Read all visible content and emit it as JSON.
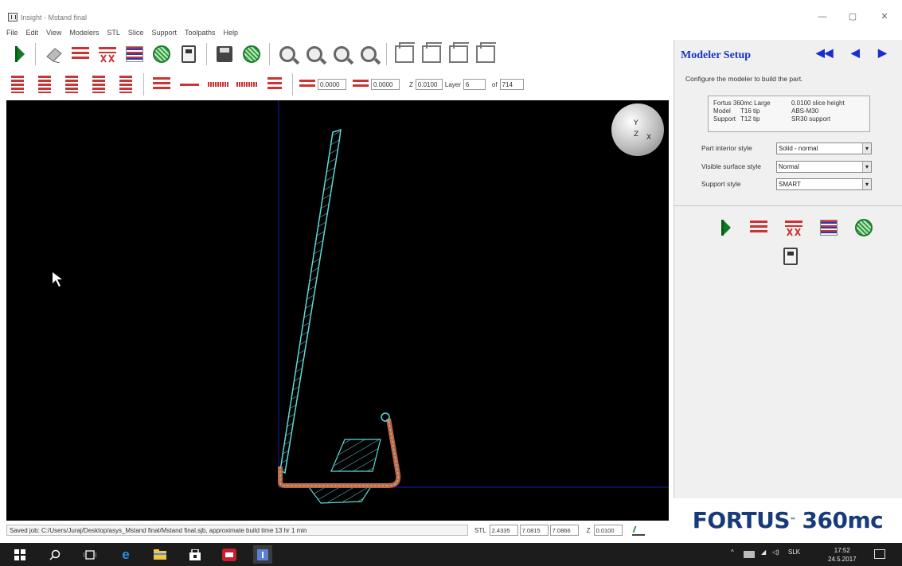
{
  "window": {
    "title": "Insight - Mstand final",
    "controls": [
      "—",
      "▢",
      "✕"
    ]
  },
  "menu": [
    "File",
    "Edit",
    "View",
    "Modelers",
    "STL",
    "Slice",
    "Support",
    "Toolpaths",
    "Help"
  ],
  "toolbar1": {
    "icons": [
      "flag-icon",
      "stl-icon",
      "slice-icon",
      "support-icon",
      "toolpath-icon",
      "pack-icon",
      "modeler-icon",
      "save-icon",
      "save-pack-icon",
      "zoom-in-icon",
      "zoom-window-icon",
      "zoom-out-icon",
      "zoom-fit-icon",
      "view-front-icon",
      "view-top-icon",
      "view-side-icon",
      "view-iso-icon"
    ]
  },
  "toolbar2": {
    "field1_value": "0.0000",
    "field2_value": "0.0000",
    "z_label": "Z",
    "z_value": "0.0100",
    "layer_label": "Layer",
    "layer_value": "6",
    "of_label": "of",
    "of_value": "714"
  },
  "viewport": {
    "orientation": {
      "y": "Y",
      "z": "Z",
      "x": "X"
    },
    "background_color": "#000000",
    "curve_color": "#5fd8d8",
    "support_color": "#c8633e"
  },
  "panel": {
    "title": "Modeler Setup",
    "nav": [
      "◀◀",
      "◀",
      "▶"
    ],
    "description": "Configure the modeler to build the part.",
    "info": [
      {
        "c1": "Fortus 360mc Large",
        "c2": "",
        "c3": "0.0100 slice height"
      },
      {
        "c1": "Model",
        "c2": "T16 tip",
        "c3": "ABS-M30"
      },
      {
        "c1": "Support",
        "c2": "T12 tip",
        "c3": "SR30 support"
      }
    ],
    "settings": [
      {
        "label": "Part interior style",
        "value": "Solid - normal"
      },
      {
        "label": "Visible surface style",
        "value": "Normal"
      },
      {
        "label": "Support style",
        "value": "SMART"
      }
    ],
    "brand": "FORTUS",
    "brand_model": "360mc"
  },
  "status": {
    "text": "Saved job: C:/Users/Juraj/Desktop/asys_Mstand final/Mstand final.sjb, approximate build time 13 hr 1 min",
    "stl_label": "STL",
    "stl_values": [
      "2.4335",
      "7.0815",
      "7.0866"
    ],
    "z_label": "Z",
    "z_value": "0.0100"
  },
  "taskbar": {
    "tray_lang": "SLK",
    "time": "17:52",
    "date": "24.5.2017"
  }
}
